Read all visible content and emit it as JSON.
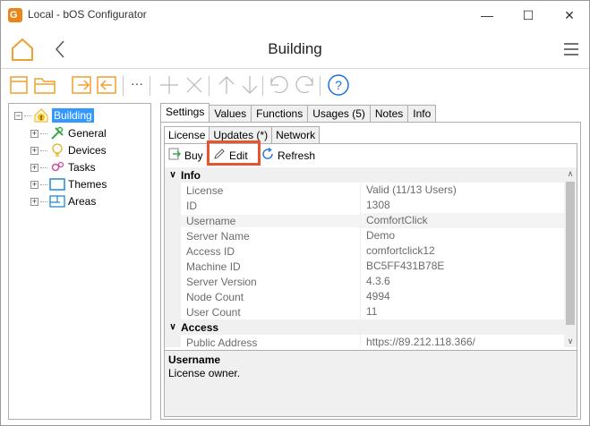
{
  "window": {
    "title": "Local - bOS Configurator",
    "minimize": "—",
    "maximize": "☐",
    "close": "✕",
    "app_icon_glyph": "G"
  },
  "header": {
    "title": "Building",
    "icons": [
      "home-icon",
      "back-icon",
      "menu-icon"
    ]
  },
  "toolbar": {
    "more_label": "···",
    "icons": [
      "new-icon",
      "open-icon",
      "import-icon",
      "export-icon",
      "add-icon",
      "delete-icon",
      "move-up-icon",
      "move-down-icon",
      "undo-icon",
      "redo-icon",
      "help-icon"
    ],
    "help_glyph": "?"
  },
  "tree": {
    "root": {
      "label": "Building",
      "expander": "−"
    },
    "items": [
      {
        "label": "General",
        "icon": "tools-icon",
        "expander": "+"
      },
      {
        "label": "Devices",
        "icon": "bulb-icon",
        "expander": "+"
      },
      {
        "label": "Tasks",
        "icon": "gears-icon",
        "expander": "+"
      },
      {
        "label": "Themes",
        "icon": "monitor-icon",
        "expander": "+"
      },
      {
        "label": "Areas",
        "icon": "floorplan-icon",
        "expander": "+"
      }
    ]
  },
  "tabs": [
    "Settings",
    "Values",
    "Functions",
    "Usages (5)",
    "Notes",
    "Info"
  ],
  "subtabs": [
    "License",
    "Updates (*)",
    "Network"
  ],
  "actions": {
    "buy": "Buy",
    "edit": "Edit",
    "refresh": "Refresh"
  },
  "grid": {
    "chevron": "∨",
    "categories": [
      {
        "name": "Info",
        "rows": [
          {
            "name": "License",
            "value": "Valid (11/13 Users)"
          },
          {
            "name": "ID",
            "value": "1308"
          },
          {
            "name": "Username",
            "value": "ComfortClick"
          },
          {
            "name": "Server Name",
            "value": "Demo"
          },
          {
            "name": "Access ID",
            "value": "comfortclick12"
          },
          {
            "name": "Machine ID",
            "value": "BC5FF431B78E"
          },
          {
            "name": "Server Version",
            "value": "4.3.6"
          },
          {
            "name": "Node Count",
            "value": "4994"
          },
          {
            "name": "User Count",
            "value": "11"
          }
        ]
      },
      {
        "name": "Access",
        "rows": [
          {
            "name": "Public Address",
            "value": "https://89.212.118.366/"
          }
        ]
      }
    ],
    "scroll_up": "∧",
    "scroll_down": "∨"
  },
  "help": {
    "title": "Username",
    "description": "License owner."
  },
  "colors": {
    "accent_orange": "#f0a030",
    "highlight_border": "#e8542b",
    "selection_blue": "#3399ff"
  }
}
